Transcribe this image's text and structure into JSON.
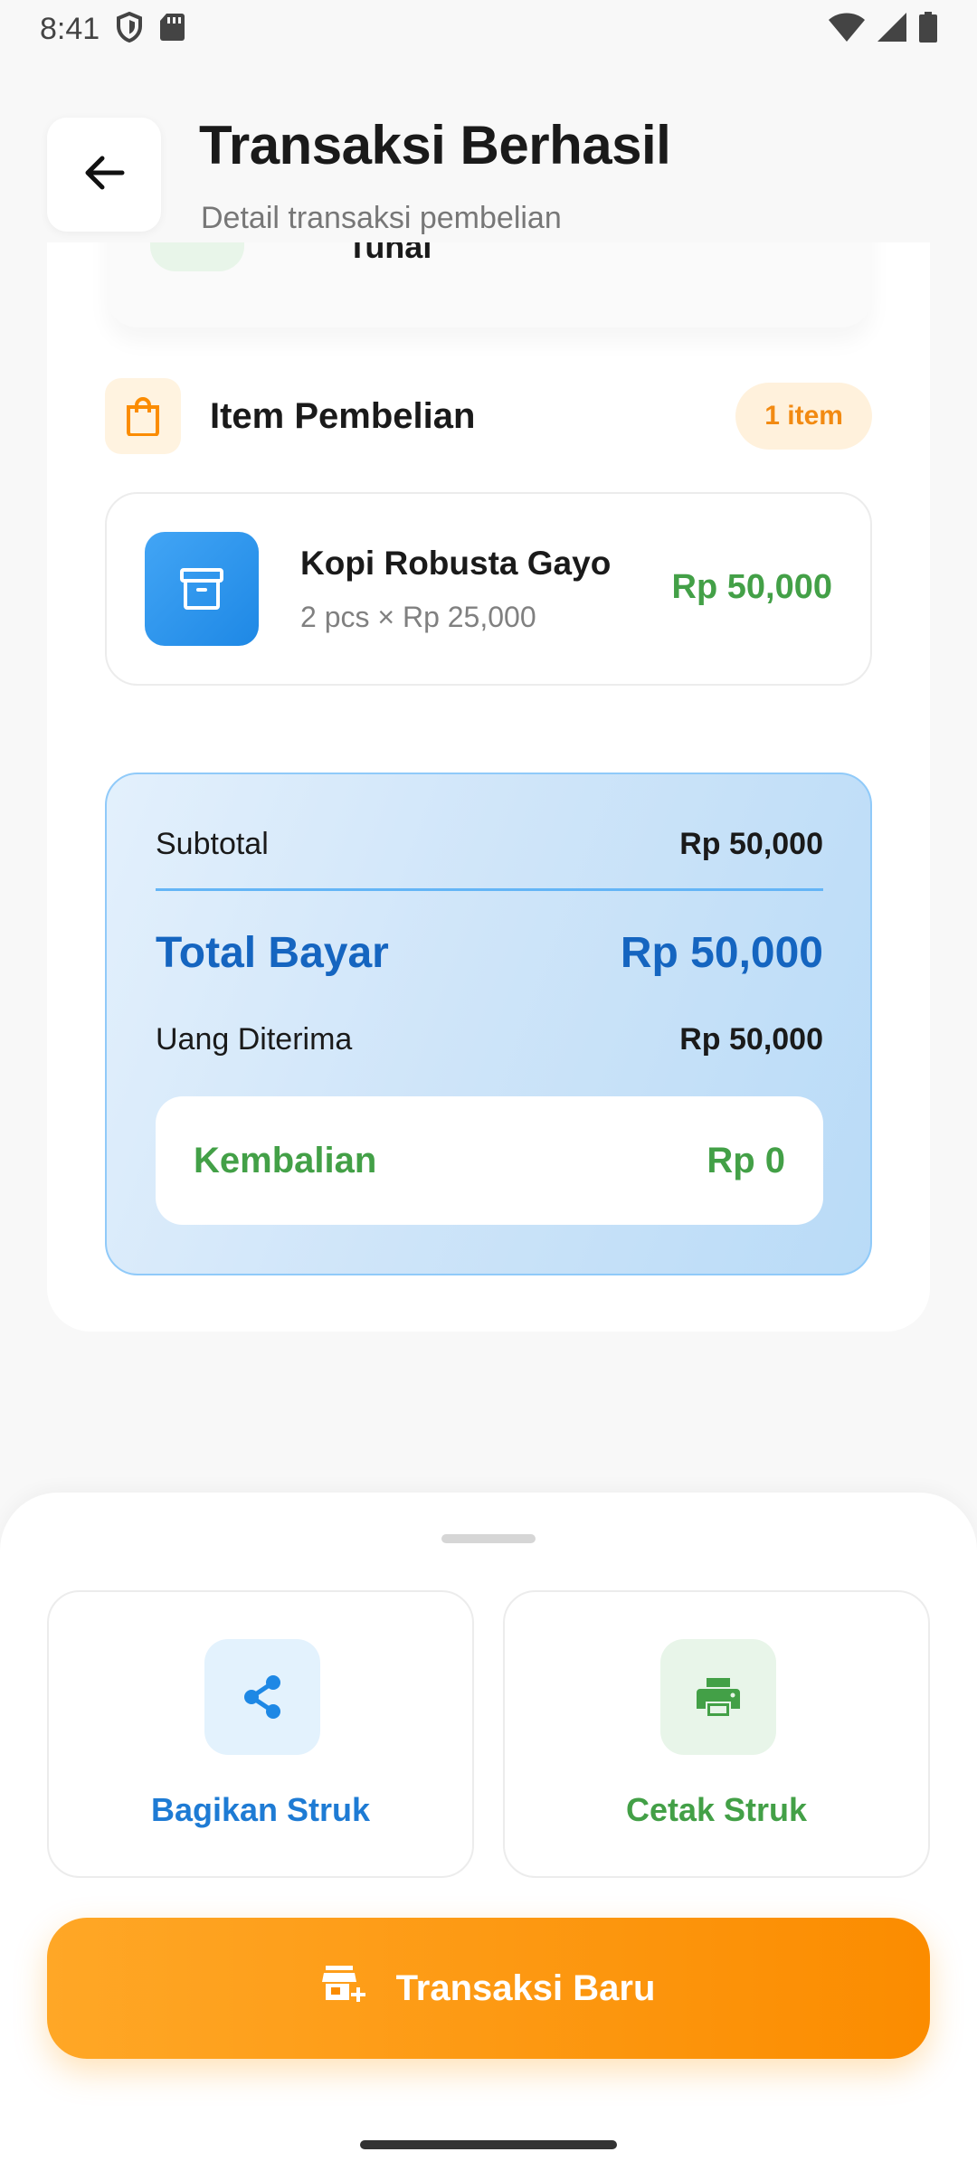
{
  "status_bar": {
    "time": "8:41"
  },
  "header": {
    "title": "Transaksi Berhasil",
    "subtitle": "Detail transaksi pembelian"
  },
  "payment": {
    "method": "Tunai"
  },
  "items_section": {
    "title": "Item Pembelian",
    "badge": "1 item",
    "items": [
      {
        "name": "Kopi Robusta Gayo",
        "detail": "2 pcs × Rp 25,000",
        "price": "Rp 50,000"
      }
    ]
  },
  "summary": {
    "subtotal_label": "Subtotal",
    "subtotal_value": "Rp 50,000",
    "total_label": "Total Bayar",
    "total_value": "Rp 50,000",
    "received_label": "Uang Diterima",
    "received_value": "Rp 50,000",
    "change_label": "Kembalian",
    "change_value": "Rp 0"
  },
  "actions": {
    "share_label": "Bagikan Struk",
    "print_label": "Cetak Struk",
    "new_transaction_label": "Transaksi Baru"
  },
  "icons": {
    "back": "arrow-left-icon",
    "section": "shopping-bag-icon",
    "item": "archive-box-icon",
    "share": "share-icon",
    "print": "printer-icon",
    "new_transaction": "add-store-icon"
  },
  "colors": {
    "accent_orange": "#fb8c00",
    "primary_blue": "#1565c0",
    "success_green": "#43a047"
  }
}
